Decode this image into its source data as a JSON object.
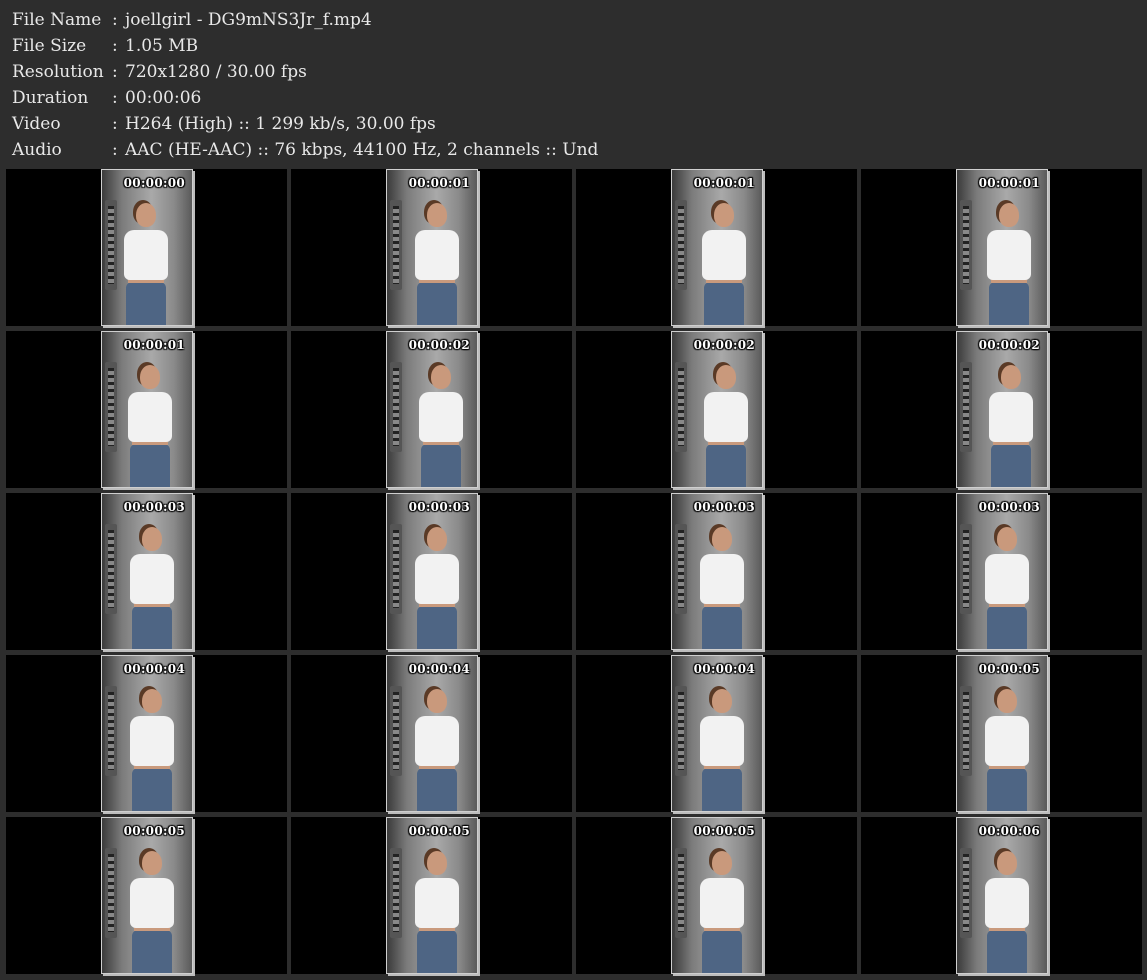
{
  "info": [
    {
      "label": "File Name",
      "sep": ":",
      "value": "joellgirl - DG9mNS3Jr_f.mp4"
    },
    {
      "label": "File Size",
      "sep": ":",
      "value": "1.05 MB"
    },
    {
      "label": "Resolution",
      "sep": ":",
      "value": "720x1280 / 30.00 fps"
    },
    {
      "label": "Duration",
      "sep": ":",
      "value": "00:00:06"
    },
    {
      "label": "Video",
      "sep": ":",
      "value": "H264 (High) :: 1 299 kb/s, 30.00 fps"
    },
    {
      "label": "Audio",
      "sep": ":",
      "value": "AAC (HE-AAC) :: 76 kbps, 44100 Hz, 2 channels :: Und"
    }
  ],
  "frames": [
    {
      "time": "00:00:00"
    },
    {
      "time": "00:00:01"
    },
    {
      "time": "00:00:01"
    },
    {
      "time": "00:00:01"
    },
    {
      "time": "00:00:01"
    },
    {
      "time": "00:00:02"
    },
    {
      "time": "00:00:02"
    },
    {
      "time": "00:00:02"
    },
    {
      "time": "00:00:03"
    },
    {
      "time": "00:00:03"
    },
    {
      "time": "00:00:03"
    },
    {
      "time": "00:00:03"
    },
    {
      "time": "00:00:04"
    },
    {
      "time": "00:00:04"
    },
    {
      "time": "00:00:04"
    },
    {
      "time": "00:00:05"
    },
    {
      "time": "00:00:05"
    },
    {
      "time": "00:00:05"
    },
    {
      "time": "00:00:05"
    },
    {
      "time": "00:00:06"
    }
  ]
}
